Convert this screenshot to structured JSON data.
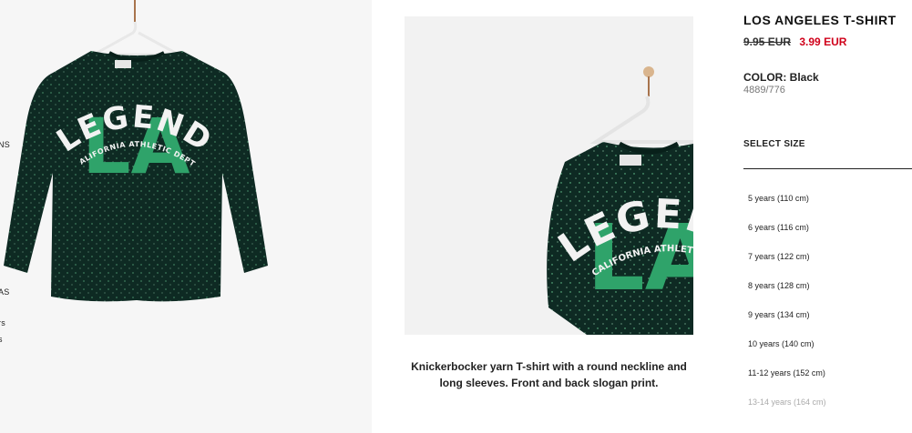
{
  "colors": {
    "price_sale": "#d0021b",
    "shirt": "#0e2a23",
    "slogan_green": "#2fa36a"
  },
  "left_nav_fragments": [
    "NS",
    "AS",
    "rs",
    "s"
  ],
  "product": {
    "name": "LOS ANGELES T-SHIRT",
    "price_old": "9.95 EUR",
    "price_new": "3.99 EUR",
    "color_label": "COLOR:",
    "color_value": "Black",
    "reference": "4889/776",
    "description": "Knickerbocker yarn T-shirt with a round neckline and long sleeves. Front and back slogan print."
  },
  "print": {
    "word": "LEGEND",
    "letters": "LA",
    "arc_text": "CALIFORNIA ATHLETIC DEPT."
  },
  "size_selector": {
    "title": "SELECT SIZE",
    "sizes": [
      {
        "label": "5 years (110 cm)"
      },
      {
        "label": "6 years (116 cm)"
      },
      {
        "label": "7 years (122 cm)"
      },
      {
        "label": "8 years (128 cm)"
      },
      {
        "label": "9 years (134 cm)"
      },
      {
        "label": "10 years (140 cm)"
      },
      {
        "label": "11-12 years (152 cm)"
      },
      {
        "label": "13-14 years (164 cm)"
      }
    ]
  }
}
